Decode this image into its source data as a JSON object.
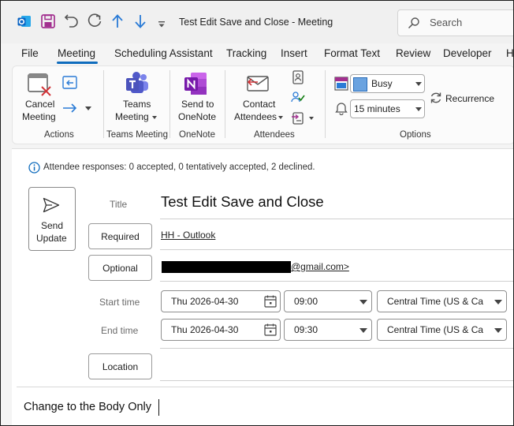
{
  "titlebar": {
    "window_title": "Test Edit Save and Close  -  Meeting",
    "search_placeholder": "Search"
  },
  "ribbon_tabs": [
    "File",
    "Meeting",
    "Scheduling Assistant",
    "Tracking",
    "Insert",
    "Format Text",
    "Review",
    "Developer",
    "H"
  ],
  "active_tab": "Meeting",
  "ribbon": {
    "cancel": {
      "line1": "Cancel",
      "line2": "Meeting"
    },
    "teams": {
      "line1": "Teams",
      "line2": "Meeting"
    },
    "onenote": {
      "line1": "Send to",
      "line2": "OneNote"
    },
    "contact": {
      "line1": "Contact",
      "line2": "Attendees"
    },
    "show_as": "Busy",
    "reminder": "15 minutes",
    "recurrence": "Recurrence",
    "groups": {
      "actions": "Actions",
      "teams_meeting": "Teams Meeting",
      "onenote": "OneNote",
      "attendees": "Attendees",
      "options": "Options"
    }
  },
  "info_bar": "Attendee responses: 0 accepted, 0 tentatively accepted, 2 declined.",
  "send_update": {
    "line1": "Send",
    "line2": "Update"
  },
  "form": {
    "title_label": "Title",
    "title_value": "Test Edit Save and Close",
    "required_label": "Required",
    "required_value": "HH - Outlook",
    "optional_label": "Optional",
    "optional_value_suffix": "@gmail.com>",
    "start_label": "Start time",
    "start_date": "Thu 2026-04-30",
    "start_time": "09:00",
    "start_tz": "Central Time (US & Cana",
    "end_label": "End time",
    "end_date": "Thu 2026-04-30",
    "end_time": "09:30",
    "end_tz": "Central Time (US & Cana",
    "location_label": "Location"
  },
  "body_text": "Change to the Body Only",
  "colors": {
    "accent": "#0f6cbd",
    "outlook_blue": "#0a64c4",
    "save_purple": "#a22f8f",
    "cancel_red": "#d13438",
    "teams_purple": "#5059c9",
    "onenote_purple": "#7719aa",
    "busy_blue": "#6aa3e0"
  }
}
